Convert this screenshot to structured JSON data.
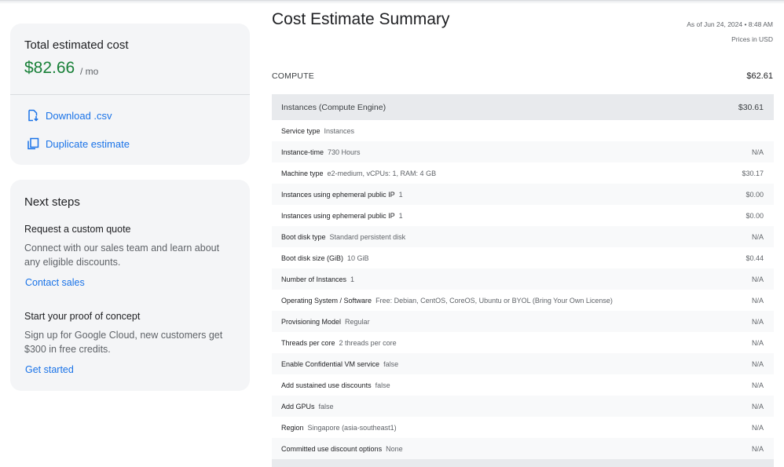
{
  "summary": {
    "total_label": "Total estimated cost",
    "total_amount": "$82.66",
    "total_unit": "/ mo",
    "download_label": "Download .csv",
    "duplicate_label": "Duplicate estimate"
  },
  "next_steps": {
    "title": "Next steps",
    "items": [
      {
        "heading": "Request a custom quote",
        "description": "Connect with our sales team and learn about any eligible discounts.",
        "link": "Contact sales"
      },
      {
        "heading": "Start your proof of concept",
        "description": "Sign up for Google Cloud, new customers get $300 in free credits.",
        "link": "Get started"
      }
    ]
  },
  "estimate": {
    "title": "Cost Estimate Summary",
    "as_of": "As of Jun 24, 2024 • 8:48 AM",
    "currency_note": "Prices in USD",
    "section": {
      "label": "COMPUTE",
      "amount": "$62.61"
    },
    "group": {
      "name": "Instances (Compute Engine)",
      "amount": "$30.61"
    },
    "rows": [
      {
        "key": "Service type",
        "value": "Instances",
        "cost": ""
      },
      {
        "key": "Instance-time",
        "value": "730 Hours",
        "cost": "N/A"
      },
      {
        "key": "Machine type",
        "value": "e2-medium, vCPUs: 1, RAM: 4 GB",
        "cost": "$30.17"
      },
      {
        "key": "Instances using ephemeral public IP",
        "value": "1",
        "cost": "$0.00"
      },
      {
        "key": "Instances using ephemeral public IP",
        "value": "1",
        "cost": "$0.00"
      },
      {
        "key": "Boot disk type",
        "value": "Standard persistent disk",
        "cost": "N/A"
      },
      {
        "key": "Boot disk size (GiB)",
        "value": "10 GiB",
        "cost": "$0.44"
      },
      {
        "key": "Number of Instances",
        "value": "1",
        "cost": "N/A"
      },
      {
        "key": "Operating System / Software",
        "value": "Free: Debian, CentOS, CoreOS, Ubuntu or BYOL (Bring Your Own License)",
        "cost": "N/A"
      },
      {
        "key": "Provisioning Model",
        "value": "Regular",
        "cost": "N/A"
      },
      {
        "key": "Threads per core",
        "value": "2 threads per core",
        "cost": "N/A"
      },
      {
        "key": "Enable Confidential VM service",
        "value": "false",
        "cost": "N/A"
      },
      {
        "key": "Add sustained use discounts",
        "value": "false",
        "cost": "N/A"
      },
      {
        "key": "Add GPUs",
        "value": "false",
        "cost": "N/A"
      },
      {
        "key": "Region",
        "value": "Singapore (asia-southeast1)",
        "cost": "N/A"
      },
      {
        "key": "Committed use discount options",
        "value": "None",
        "cost": "N/A"
      }
    ]
  },
  "colors": {
    "accent": "#1a73e8",
    "price_green": "#188038"
  },
  "icons": {
    "download": "download-file-icon",
    "duplicate": "copy-icon"
  }
}
